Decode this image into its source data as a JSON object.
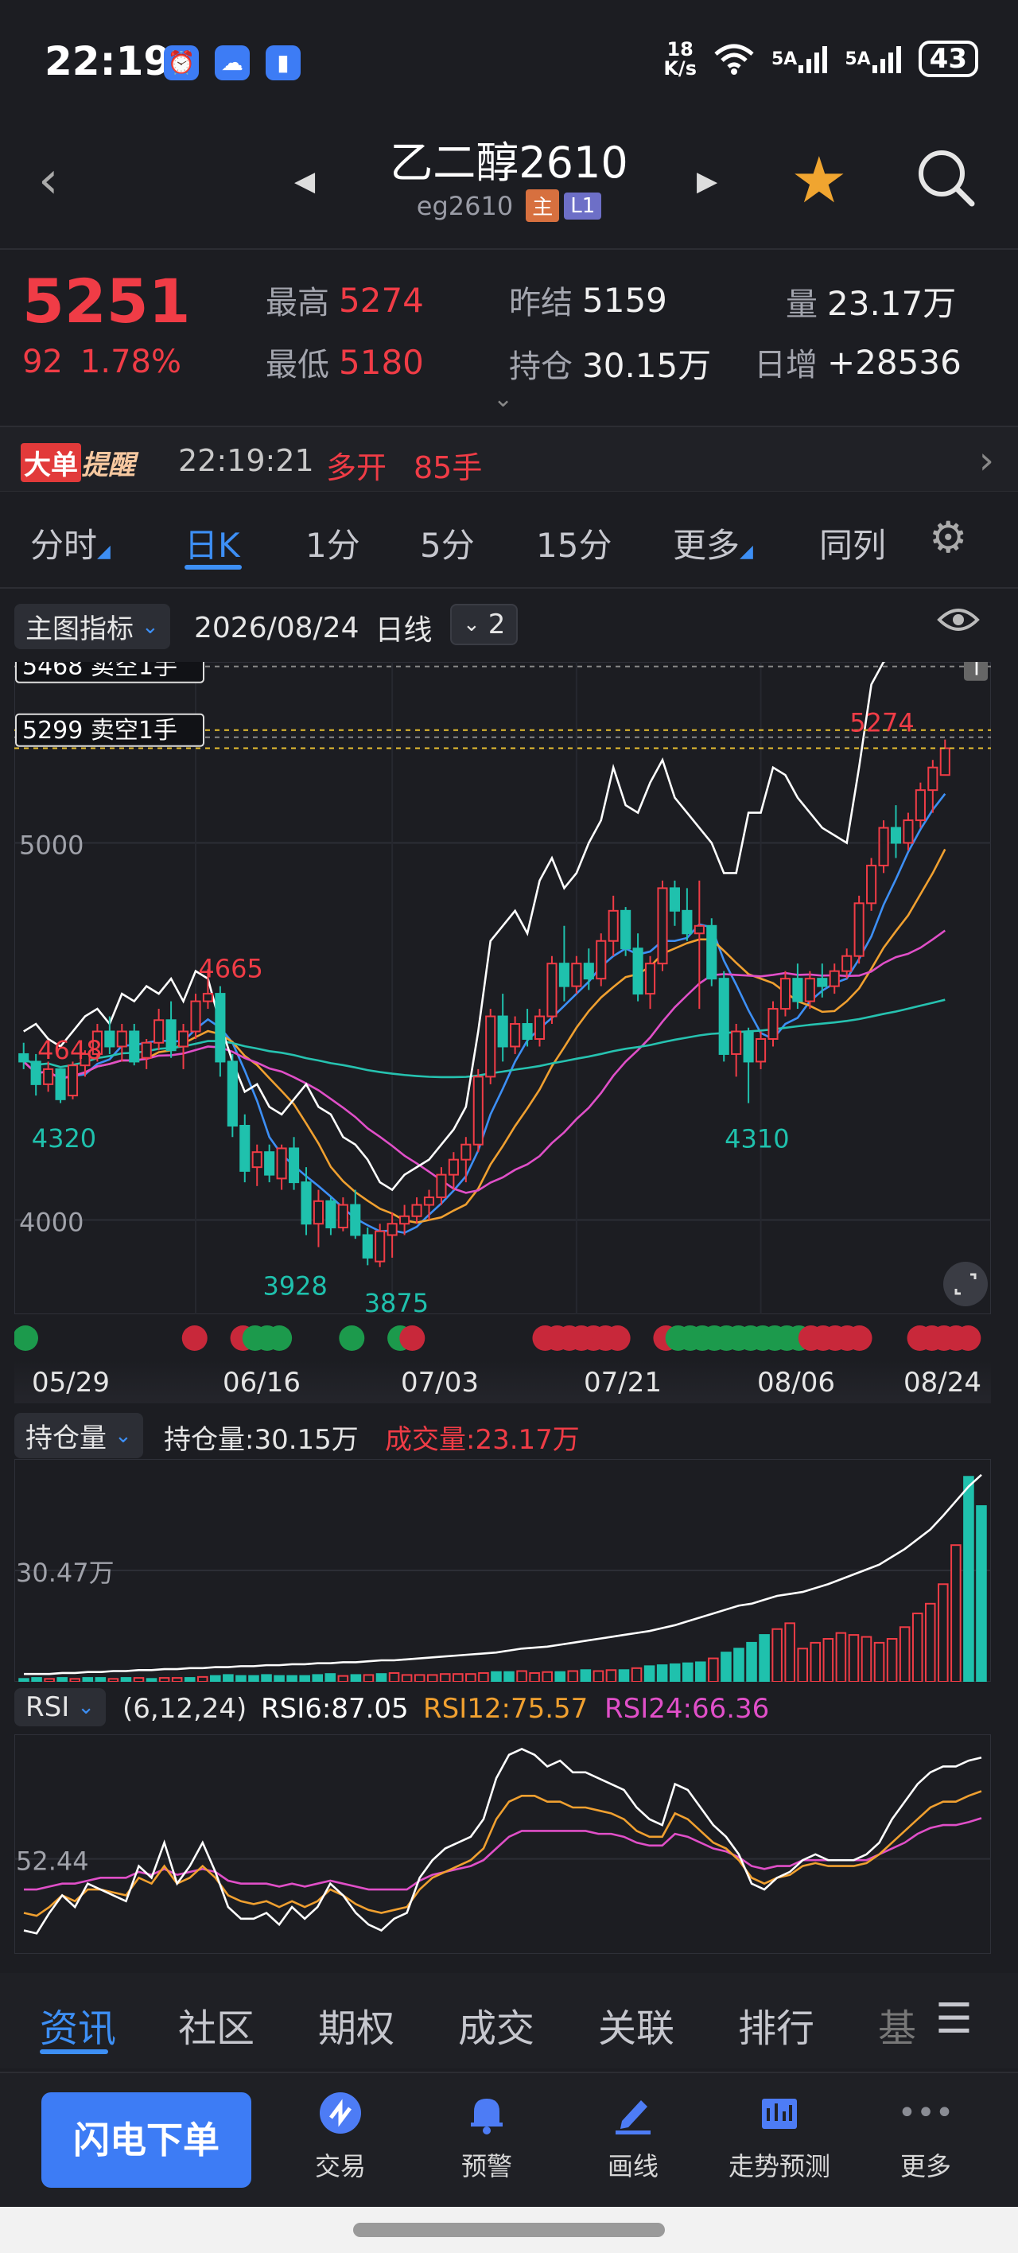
{
  "status_bar": {
    "time": "22:19",
    "net_speed_value": "18",
    "net_speed_unit": "K/s",
    "sim1": "5A",
    "sim2": "5A",
    "battery": "43"
  },
  "header": {
    "title": "乙二醇2610",
    "code": "eg2610",
    "tag_main": "主",
    "tag_level": "L1",
    "back_glyph": "‹",
    "prev_glyph": "◀",
    "next_glyph": "▶",
    "star_glyph": "★"
  },
  "quote": {
    "price": "5251",
    "change": "92",
    "change_pct": "1.78%",
    "high_label": "最高",
    "high": "5274",
    "low_label": "最低",
    "low": "5180",
    "prev_settle_label": "昨结",
    "prev_settle": "5159",
    "open_interest_label": "持仓",
    "open_interest": "30.15万",
    "volume_label": "量",
    "volume": "23.17万",
    "daily_change_label": "日增",
    "daily_change": "+28536"
  },
  "alert": {
    "badge_a": "大单",
    "badge_b": "提醒",
    "time": "22:19:21",
    "action": "多开",
    "qty": "85手"
  },
  "period_tabs": [
    "分时",
    "日K",
    "1分",
    "5分",
    "15分",
    "更多",
    "同列"
  ],
  "indicator_bar": {
    "main_indicator": "主图指标",
    "date": "2026/08/24",
    "period": "日线",
    "layers": "2"
  },
  "order_tags": [
    {
      "price": "5468",
      "text": "卖空1手"
    },
    {
      "price": "5299",
      "text": "卖空1手"
    }
  ],
  "chart_data": [
    {
      "type": "candlestick",
      "title": "",
      "x_ticks": [
        "05/29",
        "06/16",
        "07/03",
        "07/21",
        "08/06",
        "08/24"
      ],
      "y_ticks": [
        5000,
        4000
      ],
      "ylim": [
        3750,
        5480
      ],
      "annotations": [
        "4665",
        "4648",
        "4320",
        "3928",
        "3875",
        "4310",
        "5274"
      ],
      "order_marker": "T",
      "candles": [
        [
          4440,
          4470,
          4400,
          4420
        ],
        [
          4420,
          4440,
          4330,
          4360
        ],
        [
          4360,
          4420,
          4340,
          4400
        ],
        [
          4400,
          4400,
          4310,
          4320
        ],
        [
          4330,
          4420,
          4320,
          4410
        ],
        [
          4410,
          4450,
          4380,
          4440
        ],
        [
          4440,
          4520,
          4420,
          4500
        ],
        [
          4500,
          4540,
          4440,
          4460
        ],
        [
          4460,
          4520,
          4420,
          4500
        ],
        [
          4500,
          4520,
          4410,
          4420
        ],
        [
          4430,
          4480,
          4400,
          4470
        ],
        [
          4470,
          4560,
          4450,
          4530
        ],
        [
          4530,
          4580,
          4430,
          4450
        ],
        [
          4460,
          4520,
          4400,
          4500
        ],
        [
          4500,
          4600,
          4480,
          4580
        ],
        [
          4580,
          4665,
          4560,
          4600
        ],
        [
          4600,
          4620,
          4380,
          4420
        ],
        [
          4420,
          4440,
          4220,
          4250
        ],
        [
          4250,
          4280,
          4100,
          4130
        ],
        [
          4140,
          4200,
          4090,
          4180
        ],
        [
          4180,
          4200,
          4100,
          4120
        ],
        [
          4110,
          4200,
          4080,
          4190
        ],
        [
          4190,
          4220,
          4080,
          4100
        ],
        [
          4100,
          4140,
          3960,
          3990
        ],
        [
          3990,
          4080,
          3928,
          4050
        ],
        [
          4050,
          4060,
          3960,
          3980
        ],
        [
          3980,
          4060,
          3970,
          4040
        ],
        [
          4040,
          4080,
          3950,
          3960
        ],
        [
          3960,
          3980,
          3880,
          3900
        ],
        [
          3890,
          3990,
          3875,
          3970
        ],
        [
          3960,
          4020,
          3900,
          3990
        ],
        [
          3990,
          4040,
          3960,
          4010
        ],
        [
          4010,
          4060,
          3990,
          4040
        ],
        [
          4040,
          4080,
          4000,
          4060
        ],
        [
          4060,
          4140,
          4040,
          4120
        ],
        [
          4120,
          4180,
          4080,
          4160
        ],
        [
          4160,
          4220,
          4100,
          4200
        ],
        [
          4200,
          4400,
          4180,
          4380
        ],
        [
          4380,
          4560,
          4360,
          4540
        ],
        [
          4540,
          4600,
          4420,
          4460
        ],
        [
          4460,
          4540,
          4440,
          4520
        ],
        [
          4520,
          4560,
          4460,
          4480
        ],
        [
          4480,
          4560,
          4460,
          4540
        ],
        [
          4540,
          4700,
          4520,
          4680
        ],
        [
          4680,
          4780,
          4580,
          4620
        ],
        [
          4620,
          4700,
          4600,
          4680
        ],
        [
          4680,
          4720,
          4610,
          4640
        ],
        [
          4640,
          4760,
          4620,
          4740
        ],
        [
          4740,
          4860,
          4700,
          4820
        ],
        [
          4820,
          4830,
          4700,
          4720
        ],
        [
          4720,
          4760,
          4580,
          4600
        ],
        [
          4600,
          4700,
          4560,
          4680
        ],
        [
          4680,
          4900,
          4660,
          4880
        ],
        [
          4880,
          4900,
          4780,
          4820
        ],
        [
          4820,
          4880,
          4740,
          4760
        ],
        [
          4760,
          4900,
          4560,
          4780
        ],
        [
          4780,
          4800,
          4620,
          4640
        ],
        [
          4640,
          4660,
          4420,
          4440
        ],
        [
          4440,
          4520,
          4380,
          4500
        ],
        [
          4500,
          4510,
          4310,
          4420
        ],
        [
          4420,
          4500,
          4400,
          4480
        ],
        [
          4480,
          4580,
          4460,
          4560
        ],
        [
          4560,
          4660,
          4540,
          4640
        ],
        [
          4640,
          4680,
          4560,
          4580
        ],
        [
          4580,
          4660,
          4560,
          4640
        ],
        [
          4640,
          4680,
          4590,
          4620
        ],
        [
          4620,
          4680,
          4600,
          4660
        ],
        [
          4660,
          4720,
          4640,
          4700
        ],
        [
          4700,
          4860,
          4680,
          4840
        ],
        [
          4840,
          4960,
          4820,
          4940
        ],
        [
          4940,
          5060,
          4920,
          5040
        ],
        [
          5040,
          5100,
          4960,
          5000
        ],
        [
          5000,
          5080,
          4980,
          5060
        ],
        [
          5060,
          5160,
          5040,
          5140
        ],
        [
          5140,
          5220,
          5080,
          5200
        ],
        [
          5180,
          5274,
          5180,
          5251
        ]
      ],
      "series": [
        {
          "name": "",
          "color": "#3d8ff5",
          "period": 5
        },
        {
          "name": "",
          "color": "#f0a030",
          "period": 10
        },
        {
          "name": "",
          "color": "#e04fc8",
          "period": 20
        },
        {
          "name": "",
          "color": "#26c2b0",
          "period": 60
        },
        {
          "name": "",
          "color": "#ffffff",
          "period": 0,
          "values": [
            4500,
            4520,
            4480,
            4460,
            4500,
            4540,
            4560,
            4520,
            4600,
            4580,
            4620,
            4600,
            4640,
            4580,
            4660,
            4640,
            4520,
            4420,
            4340,
            4360,
            4300,
            4280,
            4320,
            4360,
            4300,
            4280,
            4220,
            4200,
            4160,
            4100,
            4080,
            4120,
            4140,
            4160,
            4200,
            4240,
            4300,
            4500,
            4740,
            4780,
            4820,
            4760,
            4900,
            4960,
            4880,
            4920,
            5000,
            5060,
            5200,
            5100,
            5080,
            5160,
            5220,
            5120,
            5080,
            5040,
            5000,
            4920,
            4920,
            5080,
            5080,
            5200,
            5180,
            5120,
            5080,
            5040,
            5020,
            5000,
            5200,
            5420,
            5480,
            5500,
            5520,
            5560,
            5600,
            5640
          ]
        }
      ]
    },
    {
      "type": "bar",
      "title": "持仓量",
      "y_ticks": [
        "30.47万"
      ],
      "line_label": "持仓量:30.15万",
      "bar_label": "成交量:23.17万",
      "volumes": [
        3,
        4,
        3,
        4,
        3,
        4,
        4,
        3,
        4,
        4,
        3,
        4,
        4,
        4,
        5,
        6,
        7,
        6,
        6,
        7,
        6,
        6,
        6,
        7,
        8,
        6,
        7,
        7,
        8,
        9,
        7,
        7,
        7,
        8,
        8,
        8,
        9,
        10,
        10,
        11,
        9,
        10,
        10,
        11,
        12,
        11,
        12,
        12,
        14,
        16,
        17,
        18,
        19,
        20,
        24,
        30,
        34,
        40,
        48,
        54,
        60,
        34,
        40,
        44,
        50,
        48,
        46,
        40,
        44,
        56,
        70,
        80,
        100,
        140,
        210,
        180
      ],
      "colors": "ggrgrggrgrgrrgrggggggggggrgrgrrrrrrrrggrrrgrgrrgrgggggrggggrrrrrrrrrrrrrrr",
      "oi": [
        8,
        8,
        8,
        9,
        9,
        10,
        10,
        11,
        11,
        12,
        12,
        13,
        13,
        14,
        14,
        15,
        15,
        16,
        16,
        17,
        17,
        18,
        18,
        19,
        19,
        20,
        20,
        21,
        22,
        22,
        23,
        24,
        25,
        26,
        27,
        28,
        29,
        30,
        32,
        34,
        35,
        36,
        38,
        40,
        42,
        44,
        46,
        48,
        50,
        52,
        55,
        58,
        62,
        66,
        70,
        74,
        78,
        80,
        84,
        88,
        90,
        92,
        96,
        100,
        105,
        110,
        115,
        120,
        128,
        136,
        146,
        156,
        170,
        185,
        200,
        212
      ]
    },
    {
      "type": "line",
      "title": "RSI",
      "params": "(6,12,24)",
      "y_ticks": [
        "52.44"
      ],
      "ylim": [
        20,
        95
      ],
      "labels": [
        "RSI6:87.05",
        "RSI12:75.57",
        "RSI24:66.36"
      ],
      "series": [
        {
          "name": "RSI6",
          "color": "#ffffff",
          "values": [
            28,
            27,
            34,
            40,
            36,
            44,
            42,
            40,
            38,
            50,
            46,
            58,
            44,
            50,
            58,
            48,
            36,
            32,
            32,
            34,
            30,
            36,
            32,
            36,
            44,
            40,
            34,
            30,
            28,
            32,
            34,
            46,
            52,
            56,
            58,
            60,
            66,
            80,
            88,
            90,
            88,
            84,
            86,
            82,
            82,
            80,
            78,
            76,
            70,
            66,
            64,
            78,
            76,
            70,
            64,
            60,
            54,
            44,
            42,
            46,
            48,
            52,
            54,
            52,
            52,
            52,
            54,
            58,
            66,
            72,
            78,
            82,
            84,
            84,
            86,
            87.05
          ]
        },
        {
          "name": "RSI12",
          "color": "#f0a030",
          "values": [
            34,
            33,
            36,
            40,
            38,
            42,
            42,
            41,
            40,
            46,
            44,
            50,
            44,
            46,
            50,
            46,
            40,
            38,
            37,
            38,
            36,
            38,
            36,
            38,
            42,
            40,
            37,
            35,
            34,
            35,
            36,
            42,
            46,
            48,
            50,
            52,
            56,
            66,
            72,
            74,
            74,
            72,
            72,
            70,
            70,
            69,
            68,
            66,
            62,
            60,
            60,
            68,
            66,
            62,
            58,
            56,
            52,
            46,
            44,
            46,
            47,
            50,
            51,
            50,
            50,
            50,
            51,
            54,
            58,
            62,
            66,
            70,
            72,
            72,
            74,
            75.57
          ]
        },
        {
          "name": "RSI24",
          "color": "#e04fc8",
          "values": [
            42,
            42,
            43,
            44,
            44,
            45,
            46,
            46,
            46,
            48,
            47,
            49,
            47,
            48,
            49,
            48,
            45,
            44,
            44,
            44,
            43,
            44,
            43,
            44,
            45,
            44,
            43,
            42,
            42,
            42,
            42,
            45,
            47,
            48,
            49,
            50,
            52,
            56,
            60,
            62,
            62,
            62,
            62,
            62,
            62,
            61,
            61,
            60,
            58,
            57,
            57,
            61,
            60,
            58,
            56,
            55,
            53,
            50,
            49,
            50,
            50,
            52,
            52,
            52,
            52,
            52,
            52,
            54,
            56,
            58,
            61,
            63,
            64,
            64,
            65,
            66.36
          ]
        }
      ]
    }
  ],
  "info_tabs": [
    "资讯",
    "社区",
    "期权",
    "成交",
    "关联",
    "排行",
    "基"
  ],
  "actions": {
    "flash_order": "闪电下单",
    "trade": "交易",
    "alert": "预警",
    "draw": "画线",
    "forecast": "走势预测",
    "more": "更多"
  }
}
